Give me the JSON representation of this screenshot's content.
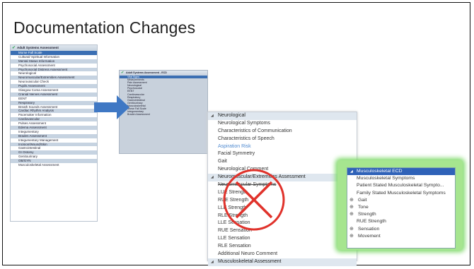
{
  "slide": {
    "title": "Documentation Changes"
  },
  "panel1": {
    "header": "Adult Systems Assessment",
    "rows": [
      {
        "label": "Morse Fall Scale",
        "style": "sel"
      },
      {
        "label": "Cultural/ Spiritual Information",
        "style": ""
      },
      {
        "label": "Mental Status Information",
        "style": "sec"
      },
      {
        "label": "Psychosocial Assessment",
        "style": ""
      },
      {
        "label": "Psychosocial Distress Assessment",
        "style": "sec"
      },
      {
        "label": "Neurological",
        "style": ""
      },
      {
        "label": "Neuromuscular/Extremities Assessment",
        "style": "sec"
      },
      {
        "label": "Neurovascular Check",
        "style": ""
      },
      {
        "label": "Pupils Assessment",
        "style": "sec"
      },
      {
        "label": "Glasgow Coma Assessment",
        "style": ""
      },
      {
        "label": "Cranial Nerves Assessment",
        "style": "sec"
      },
      {
        "label": "EENT",
        "style": ""
      },
      {
        "label": "Respiratory",
        "style": "sec"
      },
      {
        "label": "Breath Sounds Assessment",
        "style": ""
      },
      {
        "label": "Cardiac Rhythm Analysis",
        "style": "sec"
      },
      {
        "label": "Pacemaker Information",
        "style": ""
      },
      {
        "label": "Cardiovascular",
        "style": "sec"
      },
      {
        "label": "Pulses Assessment",
        "style": ""
      },
      {
        "label": "Edema Assessment",
        "style": "sec"
      },
      {
        "label": "Integumentary",
        "style": ""
      },
      {
        "label": "Braden Assessment",
        "style": "sec"
      },
      {
        "label": "Integumentary Management",
        "style": ""
      },
      {
        "label": "Incision/Wound/Skin",
        "style": "sec"
      },
      {
        "label": "Gastrointestinal",
        "style": ""
      },
      {
        "label": "GI Ostomy",
        "style": "sec"
      },
      {
        "label": "Genitourinary",
        "style": ""
      },
      {
        "label": "OB/GYN",
        "style": "sec"
      },
      {
        "label": "Musculoskeletal Assessment",
        "style": ""
      }
    ]
  },
  "panel2": {
    "header": "Adult Systems Assessment - ECD",
    "rows": [
      {
        "label": "Vital Signs",
        "style": "sel"
      },
      {
        "label": "Measurements",
        "style": ""
      },
      {
        "label": "Pain Assessment",
        "style": ""
      },
      {
        "label": "Neurological",
        "style": ""
      },
      {
        "label": "Psychosocial",
        "style": ""
      },
      {
        "label": "EENT",
        "style": ""
      },
      {
        "label": "Cardiovascular",
        "style": ""
      },
      {
        "label": "Respiratory",
        "style": ""
      },
      {
        "label": "Gastrointestinal",
        "style": ""
      },
      {
        "label": "Genitourinary",
        "style": ""
      },
      {
        "label": "Musculoskeletal",
        "style": ""
      },
      {
        "label": "Morse Fall Scale",
        "style": ""
      },
      {
        "label": "Integumentary",
        "style": ""
      },
      {
        "label": "Braden Assessment",
        "style": ""
      }
    ]
  },
  "panel3": {
    "rows": [
      {
        "label": "Neurological",
        "style": "sec"
      },
      {
        "label": "Neurological Symptoms",
        "style": ""
      },
      {
        "label": "Characteristics of Communication",
        "style": ""
      },
      {
        "label": "Characteristics of Speech",
        "style": ""
      },
      {
        "label": "Aspiration Risk",
        "style": "link"
      },
      {
        "label": "Facial Symmetry",
        "style": ""
      },
      {
        "label": "Gait",
        "style": ""
      },
      {
        "label": "Neurological Comment",
        "style": ""
      },
      {
        "label": "Neuromuscular/Extremities Assessment",
        "style": "sec"
      },
      {
        "label": "Neuromuscular Symptoms",
        "style": "strike"
      },
      {
        "label": "LUE Strength",
        "style": ""
      },
      {
        "label": "RUE Strength",
        "style": ""
      },
      {
        "label": "LLE Strength",
        "style": ""
      },
      {
        "label": "RLE Strength",
        "style": ""
      },
      {
        "label": "LLE Sensation",
        "style": ""
      },
      {
        "label": "RUE Sensation",
        "style": ""
      },
      {
        "label": "LLE Sensation",
        "style": ""
      },
      {
        "label": "RLE Sensation",
        "style": ""
      },
      {
        "label": "Additional Neuro Comment",
        "style": ""
      },
      {
        "label": "Musculoskeletal Assessment",
        "style": "sec"
      }
    ]
  },
  "panel4": {
    "rows": [
      {
        "label": "Musculoskeletal ECD",
        "style": "sel",
        "icon": ""
      },
      {
        "label": "Musculoskeletal Symptoms",
        "style": "",
        "icon": ""
      },
      {
        "label": "Patient Stated Musculoskeletal Sympto...",
        "style": "",
        "icon": ""
      },
      {
        "label": "Family Stated Musculoskeletal Symptoms",
        "style": "",
        "icon": ""
      },
      {
        "label": "Gait",
        "style": "ic",
        "icon": "⊕"
      },
      {
        "label": "Tone",
        "style": "ic",
        "icon": "⊕"
      },
      {
        "label": "Strength",
        "style": "ic",
        "icon": "⊕"
      },
      {
        "label": "RUE Strength",
        "style": "",
        "icon": ""
      },
      {
        "label": "Sensation",
        "style": "ic",
        "icon": "⊕"
      },
      {
        "label": "Movement",
        "style": "ic",
        "icon": "⊕"
      }
    ]
  },
  "colors": {
    "selection": "#3b6fb3",
    "arrow": "#3f78c4",
    "x_mark": "#e0322b",
    "highlight": "#7fd96a"
  }
}
